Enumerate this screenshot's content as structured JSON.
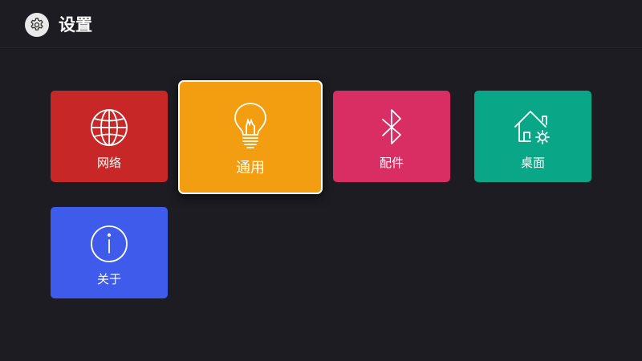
{
  "header": {
    "icon": "gear-icon",
    "title": "设置"
  },
  "tiles": [
    {
      "label": "网络",
      "icon": "globe-icon",
      "color": "#c72726",
      "focused": false
    },
    {
      "label": "通用",
      "icon": "lightbulb-icon",
      "color": "#f39d11",
      "focused": true
    },
    {
      "label": "配件",
      "icon": "bluetooth-icon",
      "color": "#d92e63",
      "focused": false
    },
    {
      "label": "桌面",
      "icon": "home-settings-icon",
      "color": "#0aa688",
      "focused": false
    },
    {
      "label": "关于",
      "icon": "info-icon",
      "color": "#3f5bec",
      "focused": false
    }
  ],
  "colors": {
    "background": "#1c1c22",
    "header_icon_bg": "#e9e9ea"
  }
}
